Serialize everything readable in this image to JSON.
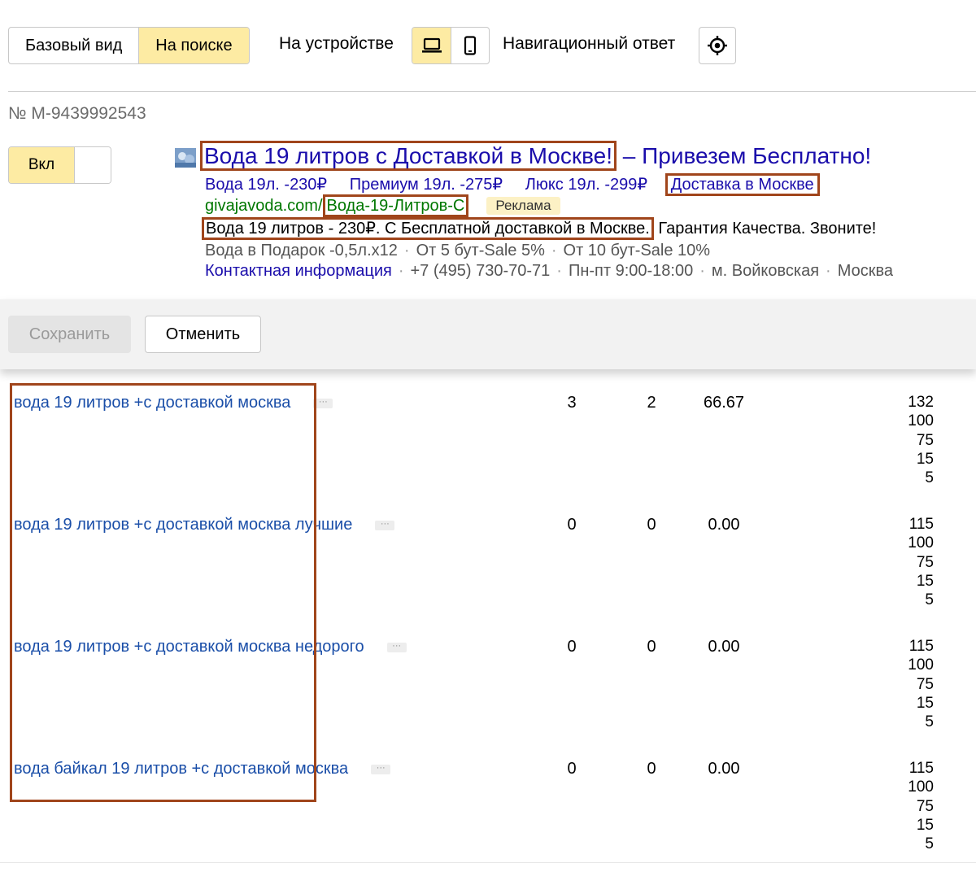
{
  "toolbar": {
    "view_options": [
      "Базовый вид",
      "На поиске"
    ],
    "device_label": "На устройстве",
    "nav_answer_label": "Навигационный ответ"
  },
  "order_number": "№ М-9439992543",
  "toggle_label": "Вкл",
  "ad": {
    "title_highlight": "Вода 19 литров с Доставкой в Москве!",
    "title_rest": " – Привезем Бесплатно!",
    "sitelinks": [
      "Вода 19л. -230₽",
      "Премиум 19л. -275₽",
      "Люкс 19л. -299₽",
      "Доставка в Москве"
    ],
    "domain": "givajavoda.com/",
    "path": "Вода-19-Литров-С",
    "ad_badge": "Реклама",
    "description_highlight": "Вода 19 литров - 230₽. С Бесплатной доставкой в Москве.",
    "description_rest": " Гарантия Качества. Звоните!",
    "callouts": [
      "Вода в Подарок -0,5л.х12",
      "От 5 бут-Sale 5%",
      "От 10 бут-Sale 10%"
    ],
    "contact_link": "Контактная информация",
    "phone": "+7 (495) 730-70-71",
    "hours": "Пн-пт 9:00-18:00",
    "metro": "м. Войковская",
    "city": "Москва"
  },
  "actions": {
    "save": "Сохранить",
    "cancel": "Отменить"
  },
  "keywords": [
    {
      "text": "вода 19 литров +с доставкой москва",
      "more": "···",
      "c1": "3",
      "c2": "2",
      "c3": "66.67",
      "bids": [
        "132",
        "100",
        "75",
        "15",
        "5"
      ]
    },
    {
      "text": "вода 19 литров +с доставкой москва лучшие",
      "more": "···",
      "c1": "0",
      "c2": "0",
      "c3": "0.00",
      "bids": [
        "115",
        "100",
        "75",
        "15",
        "5"
      ]
    },
    {
      "text": "вода 19 литров +с доставкой москва недорого",
      "more": "···",
      "c1": "0",
      "c2": "0",
      "c3": "0.00",
      "bids": [
        "115",
        "100",
        "75",
        "15",
        "5"
      ]
    },
    {
      "text": "вода байкал 19 литров +с доставкой москва",
      "more": "···",
      "c1": "0",
      "c2": "0",
      "c3": "0.00",
      "bids": [
        "115",
        "100",
        "75",
        "15",
        "5"
      ]
    }
  ]
}
